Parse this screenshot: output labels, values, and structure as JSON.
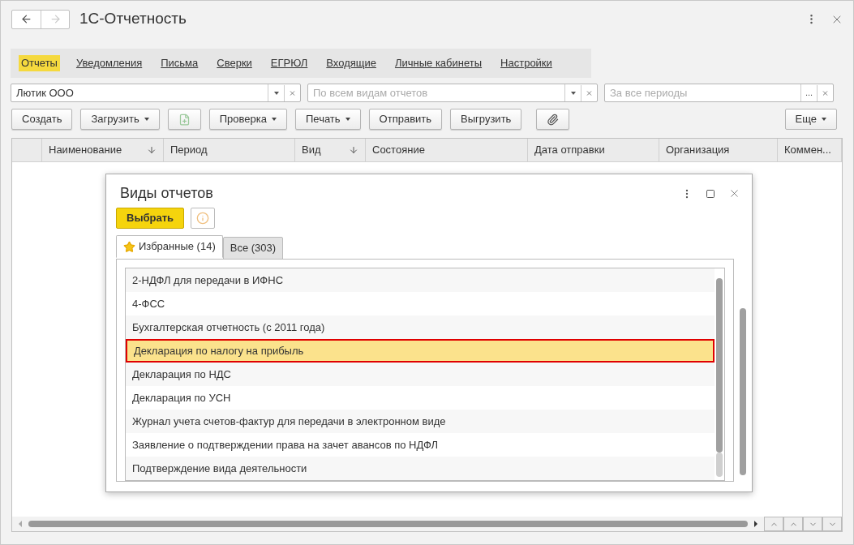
{
  "window": {
    "title": "1С-Отчетность"
  },
  "nav_tabs": [
    {
      "label": "Отчеты",
      "selected": true
    },
    {
      "label": "Уведомления",
      "selected": false
    },
    {
      "label": "Письма",
      "selected": false
    },
    {
      "label": "Сверки",
      "selected": false
    },
    {
      "label": "ЕГРЮЛ",
      "selected": false
    },
    {
      "label": "Входящие",
      "selected": false
    },
    {
      "label": "Личные кабинеты",
      "selected": false
    },
    {
      "label": "Настройки",
      "selected": false
    }
  ],
  "filters": {
    "organization": {
      "value": "Лютик ООО"
    },
    "report_type": {
      "placeholder": "По всем видам отчетов"
    },
    "period": {
      "placeholder": "За все периоды",
      "picker": "..."
    }
  },
  "toolbar": [
    {
      "kind": "text",
      "label": "Создать"
    },
    {
      "kind": "menu",
      "label": "Загрузить"
    },
    {
      "kind": "icon",
      "disabled": true
    },
    {
      "kind": "menu",
      "label": "Проверка"
    },
    {
      "kind": "menu",
      "label": "Печать"
    },
    {
      "kind": "text",
      "label": "Отправить"
    },
    {
      "kind": "text",
      "label": "Выгрузить"
    },
    {
      "kind": "clip"
    }
  ],
  "more_button": {
    "label": "Еще"
  },
  "table": {
    "columns": [
      {
        "label": "Наименование",
        "sorted": true
      },
      {
        "label": "Период",
        "sorted": false
      },
      {
        "label": "Вид",
        "sorted": true
      },
      {
        "label": "Состояние",
        "sorted": false
      },
      {
        "label": "Дата отправки",
        "sorted": false
      },
      {
        "label": "Организация",
        "sorted": false
      },
      {
        "label": "Коммен...",
        "sorted": false
      }
    ]
  },
  "dialog": {
    "title": "Виды отчетов",
    "select_button": "Выбрать",
    "tabs": [
      {
        "label": "Избранные (14)",
        "selected": true
      },
      {
        "label": "Все (303)",
        "selected": false
      }
    ],
    "items": [
      {
        "label": "2-НДФЛ для передачи в ИФНС",
        "selected": false
      },
      {
        "label": "4-ФСС",
        "selected": false
      },
      {
        "label": "Бухгалтерская отчетность (с 2011 года)",
        "selected": false
      },
      {
        "label": "Декларация по налогу на прибыль",
        "selected": true
      },
      {
        "label": "Декларация по НДС",
        "selected": false
      },
      {
        "label": "Декларация по УСН",
        "selected": false
      },
      {
        "label": "Журнал учета счетов-фактур для передачи в электронном виде",
        "selected": false
      },
      {
        "label": "Заявление о подтверждении права на зачет авансов по НДФЛ",
        "selected": false
      },
      {
        "label": "Подтверждение вида деятельности",
        "selected": false
      }
    ]
  }
}
